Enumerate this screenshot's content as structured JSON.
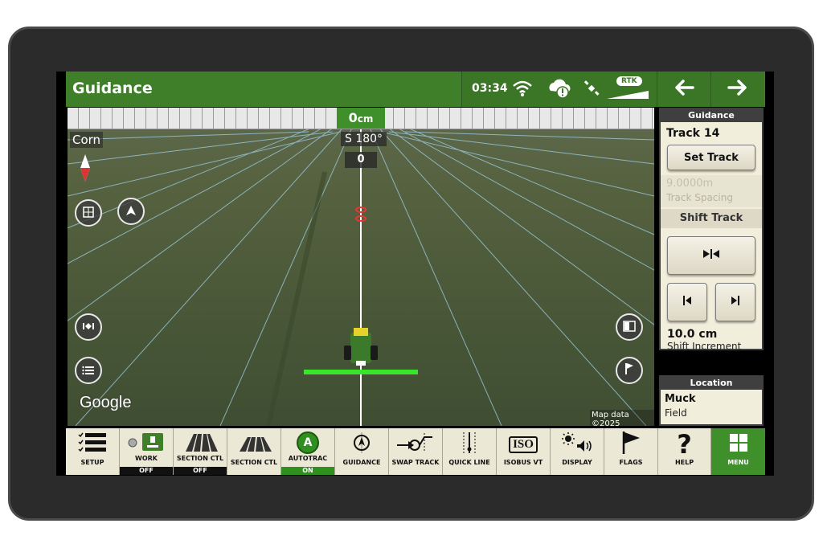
{
  "header": {
    "title": "Guidance",
    "time": "03:34",
    "rtk_label": "RTK",
    "back_icon": "arrow-left-icon",
    "forward_icon": "arrow-right-icon"
  },
  "map": {
    "offset_value": "0",
    "offset_unit": "cm",
    "heading": "S 180°",
    "lateral_value": "0",
    "crop": "Corn",
    "attribution": "Google",
    "map_data": "Map data ©2025"
  },
  "guidance_panel": {
    "header": "Guidance",
    "track_name": "Track 14",
    "set_track_label": "Set Track",
    "track_spacing_value": "9.0000m",
    "track_spacing_label": "Track Spacing",
    "shift_track_label": "Shift Track",
    "shift_increment_value": "10.0 cm",
    "shift_increment_label": "Shift Increment"
  },
  "location_panel": {
    "header": "Location",
    "name": "Muck",
    "type": "Field"
  },
  "bottom_bar": {
    "setup": "SETUP",
    "work": "WORK",
    "work_state": "OFF",
    "section_ctl_1": "SECTION CTL",
    "section_ctl_1_state": "OFF",
    "section_ctl_2": "SECTION CTL",
    "autotrac": "AUTOTRAC",
    "autotrac_state": "ON",
    "autotrac_badge": "A",
    "guidance": "GUIDANCE",
    "swap_track": "SWAP TRACK",
    "quick_line": "QUICK LINE",
    "isobus_vt": "ISOBUS VT",
    "isobus_badge": "ISO",
    "display": "DISPLAY",
    "flags": "FLAGS",
    "help": "HELP",
    "help_glyph": "?",
    "menu": "MENU"
  },
  "colors": {
    "deere_green": "#3f7f2a",
    "active_green": "#2f8f1f",
    "panel_bg": "#f2eedc",
    "guidance_line": "#39e62a"
  }
}
